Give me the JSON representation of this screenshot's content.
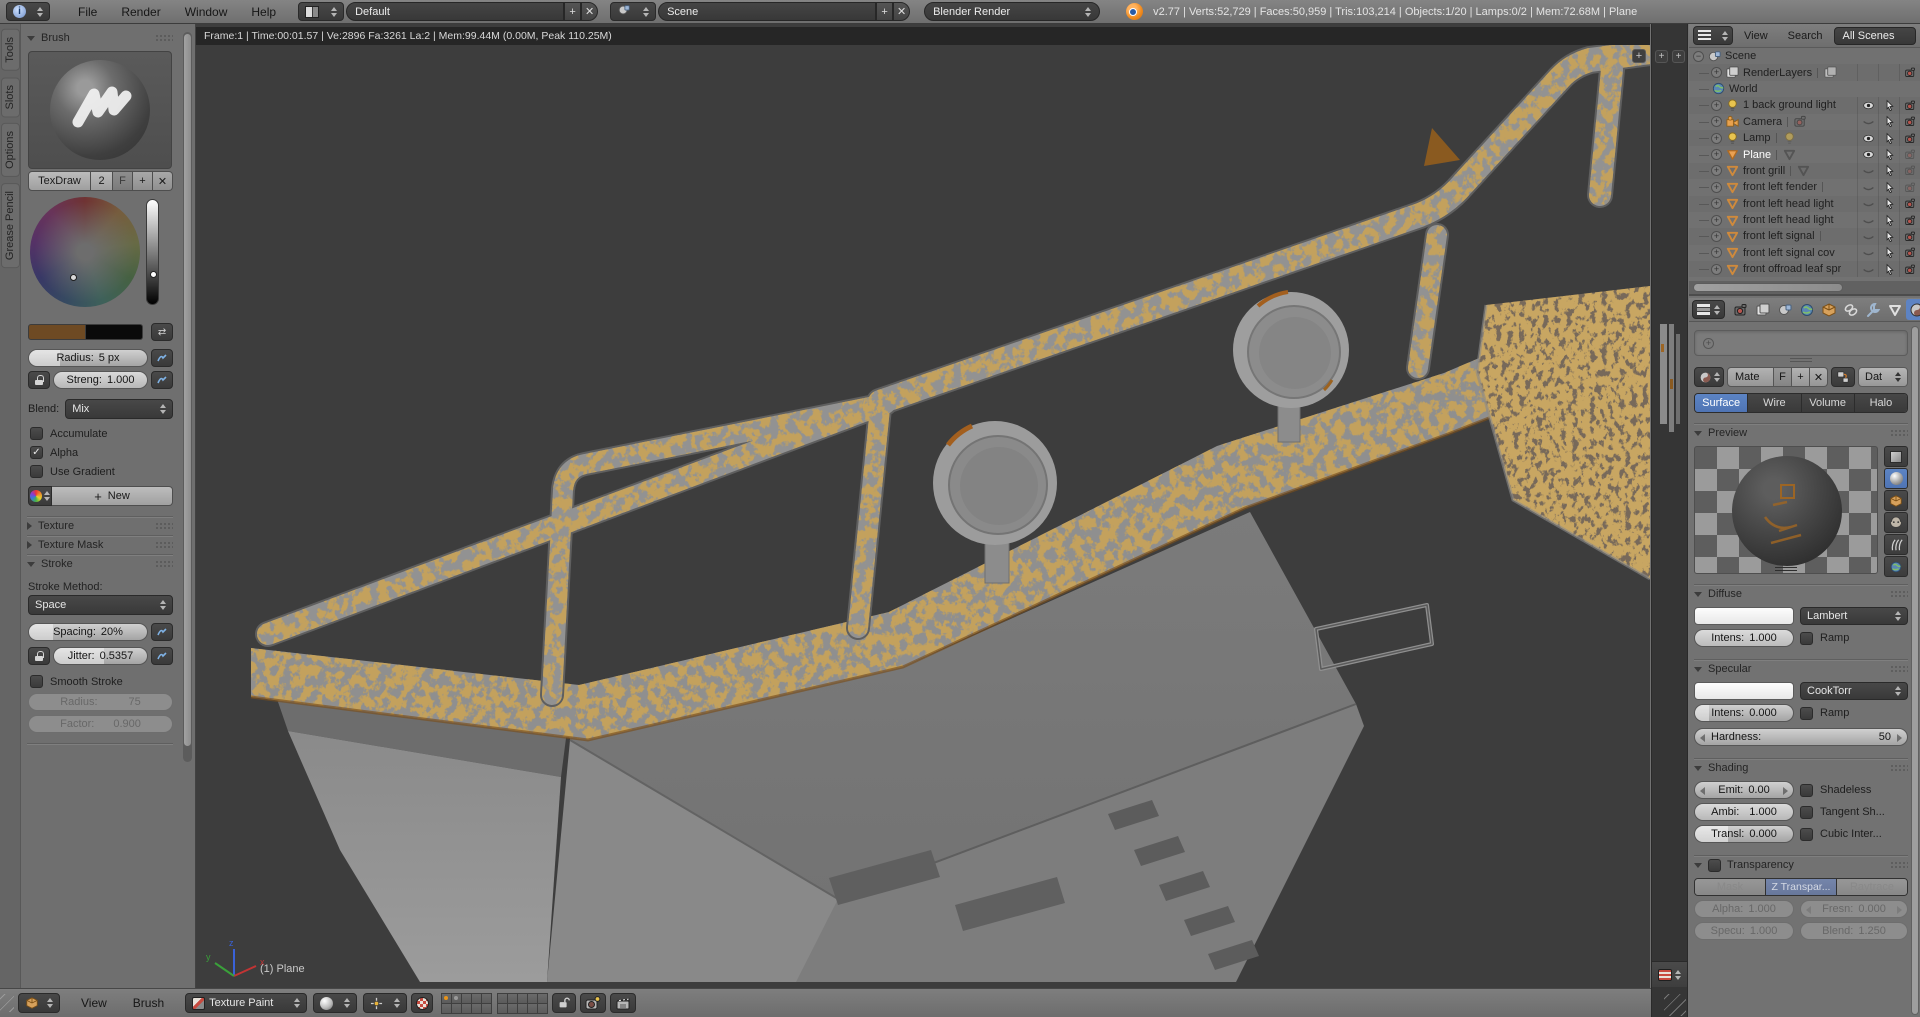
{
  "icons": {
    "check": "✓",
    "plus": "+",
    "x": "✕",
    "swap": "⇄",
    "minus": "−"
  },
  "topbar": {
    "menus": [
      "File",
      "Render",
      "Window",
      "Help"
    ],
    "layout_value": "Default",
    "scene_value": "Scene",
    "engine_value": "Blender Render",
    "stats": "v2.77 | Verts:52,729 | Faces:50,959 | Tris:103,214 | Objects:1/20 | Lamps:0/2 | Mem:72.68M | Plane"
  },
  "viewport": {
    "info": "Frame:1 | Time:00:01.57 | Ve:2896 Fa:3261 La:2 | Mem:99.44M (0.00M, Peak 110.25M)",
    "object_label": "(1) Plane",
    "axis_x": "x",
    "axis_y": "y",
    "axis_z": "z"
  },
  "tool_shelf": {
    "tabs": [
      "Tools",
      "Slots",
      "Options",
      "Grease Pencil"
    ],
    "brush": {
      "section": "Brush",
      "name": "TexDraw",
      "users": "2",
      "fake_user": "F",
      "radius_label": "Radius:",
      "radius_value": "5 px",
      "strength_label": "Streng:",
      "strength_value": "1.000",
      "blend_label": "Blend:",
      "blend_value": "Mix",
      "accumulate": "Accumulate",
      "alpha": "Alpha",
      "use_gradient": "Use Gradient",
      "new_button": "New"
    },
    "texture_section": "Texture",
    "texture_mask_section": "Texture Mask",
    "stroke": {
      "section": "Stroke",
      "method_label": "Stroke Method:",
      "method_value": "Space",
      "spacing_label": "Spacing:",
      "spacing_value": "20%",
      "jitter_label": "Jitter:",
      "jitter_value": "0.5357",
      "smooth": "Smooth Stroke",
      "radius_label": "Radius:",
      "radius_value": "75",
      "factor_label": "Factor:",
      "factor_value": "0.900"
    }
  },
  "outliner": {
    "menu_view": "View",
    "menu_search": "Search",
    "scenes_filter": "All Scenes",
    "rows": [
      {
        "name": "Scene"
      },
      {
        "name": "RenderLayers"
      },
      {
        "name": "World"
      },
      {
        "name": "1 back ground light"
      },
      {
        "name": "Camera"
      },
      {
        "name": "Lamp"
      },
      {
        "name": "Plane"
      },
      {
        "name": "front grill"
      },
      {
        "name": "front left fender"
      },
      {
        "name": "front left head light"
      },
      {
        "name": "front left head light"
      },
      {
        "name": "front left signal"
      },
      {
        "name": "front left signal cov"
      },
      {
        "name": "front offroad leaf spr"
      }
    ]
  },
  "properties": {
    "material": {
      "name": "Mate",
      "fake_user": "F",
      "datablock": "Dat"
    },
    "modes": [
      "Surface",
      "Wire",
      "Volume",
      "Halo"
    ],
    "preview_section": "Preview",
    "diffuse": {
      "section": "Diffuse",
      "shader": "Lambert",
      "intensity_label": "Intens:",
      "intensity_value": "1.000",
      "ramp": "Ramp"
    },
    "specular": {
      "section": "Specular",
      "shader": "CookTorr",
      "intensity_label": "Intens:",
      "intensity_value": "0.000",
      "ramp": "Ramp",
      "hardness_label": "Hardness:",
      "hardness_value": "50"
    },
    "shading": {
      "section": "Shading",
      "emit_label": "Emit:",
      "emit_value": "0.00",
      "ambient_label": "Ambi:",
      "ambient_value": "1.000",
      "transl_label": "Transl:",
      "transl_value": "0.000",
      "shadeless": "Shadeless",
      "tangent": "Tangent Sh...",
      "cubic": "Cubic Inter..."
    },
    "transparency": {
      "section": "Transparency",
      "modes": [
        "Mask",
        "Z Transpar...",
        "Raytrace"
      ],
      "alpha_label": "Alpha:",
      "alpha_value": "1.000",
      "fresnel_label": "Fresn:",
      "fresnel_value": "0.000",
      "specular_label": "Specu:",
      "specular_value": "1.000",
      "blend_label": "Blend:",
      "blend_value": "1.250"
    }
  },
  "bottom_bar": {
    "menu_view": "View",
    "menu_brush": "Brush",
    "mode": "Texture Paint"
  }
}
